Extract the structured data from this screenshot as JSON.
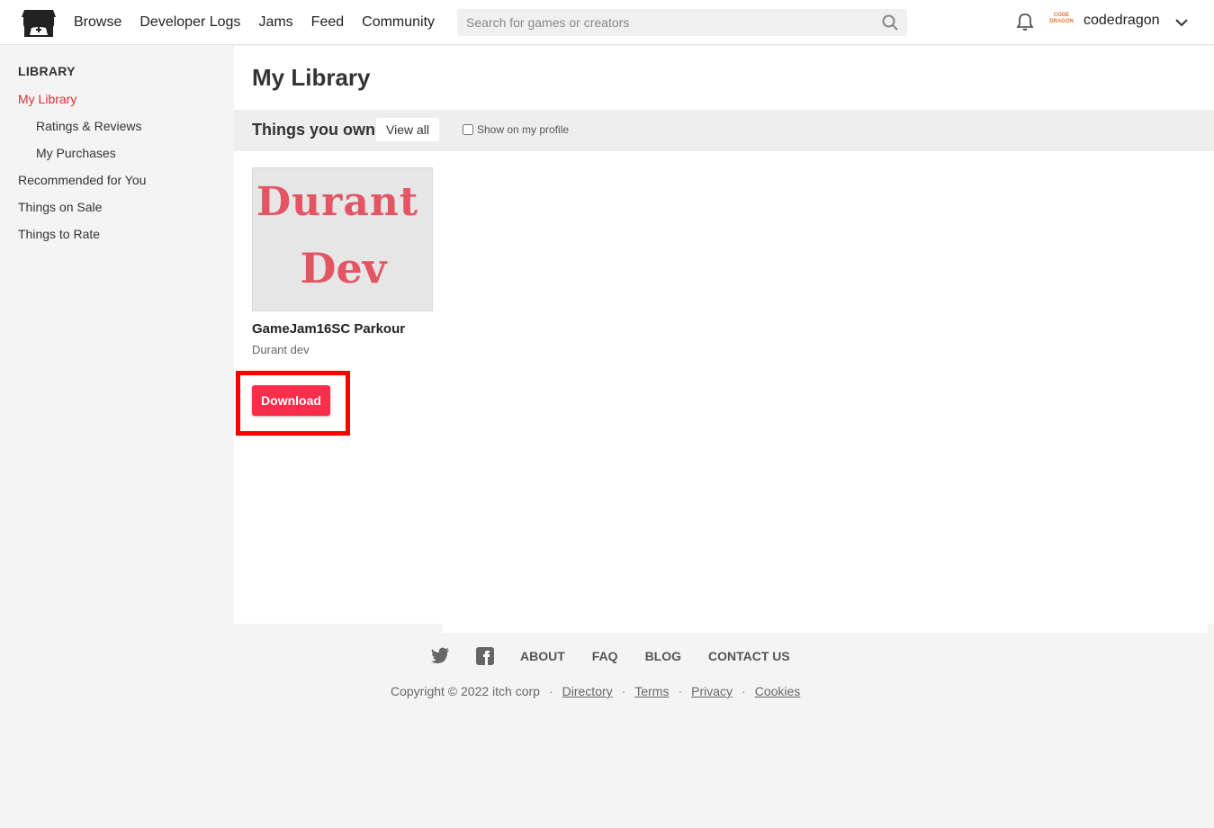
{
  "header": {
    "nav": [
      "Browse",
      "Developer Logs",
      "Jams",
      "Feed",
      "Community"
    ],
    "search_placeholder": "Search for games or creators",
    "username": "codedragon",
    "avatar_text": "CODE DRAGON"
  },
  "sidebar": {
    "title": "LIBRARY",
    "items": [
      {
        "label": "My Library",
        "active": true
      },
      {
        "label": "Ratings & Reviews"
      },
      {
        "label": "My Purchases"
      },
      {
        "label": "Recommended for You"
      },
      {
        "label": "Things on Sale"
      },
      {
        "label": "Things to Rate"
      }
    ]
  },
  "main": {
    "title": "My Library",
    "shelf_title": "Things you own",
    "view_all": "View all",
    "show_profile_label": "Show on my profile",
    "game": {
      "thumb_line1": "Durant",
      "thumb_line2": "Dev",
      "title": "GameJam16SC Parkour",
      "author": "Durant dev",
      "download_label": "Download"
    }
  },
  "footer": {
    "links": [
      "ABOUT",
      "FAQ",
      "BLOG",
      "CONTACT US"
    ],
    "copyright": "Copyright © 2022 itch corp",
    "legal": [
      "Directory",
      "Terms",
      "Privacy",
      "Cookies"
    ]
  },
  "colors": {
    "accent": "#fa2d4b",
    "active_link": "#da2c38",
    "highlight": "#ff0000"
  }
}
